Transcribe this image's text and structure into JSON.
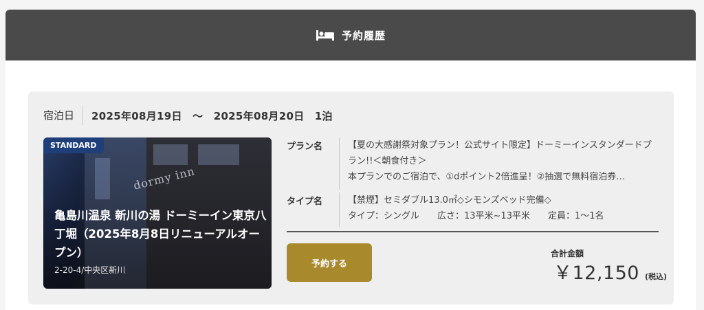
{
  "header": {
    "icon": "bed-icon",
    "title": "予約履歴"
  },
  "stay": {
    "label": "宿泊日",
    "dates_text": "2025年08月19日　～　2025年08月20日　1泊"
  },
  "hotel": {
    "badge": "STANDARD",
    "sign_text": "dormy inn",
    "name": "亀島川温泉 新川の湯 ドーミーイン東京八丁堀（2025年8月8日リニューアルオープン）",
    "address": "2-20-4/中央区新川"
  },
  "plan": {
    "label": "プラン名",
    "value_line1": "【夏の大感謝祭対象プラン！公式サイト限定】ドーミーインスタンダードプラン!!＜朝食付き＞",
    "value_line2": "本プランでのご宿泊で、①dポイント2倍進呈！②抽選で無料宿泊券…"
  },
  "room_type": {
    "label": "タイプ名",
    "value_line1": "【禁煙】セミダブル13.0㎡◇シモンズベッド完備◇",
    "value_line2": "タイプ：シングル　　広さ：13平米~13平米　　定員：1～1名"
  },
  "actions": {
    "reserve_label": "予約する"
  },
  "total": {
    "label": "合計金額",
    "amount": "￥12,150",
    "tax_note": "(税込)"
  },
  "colors": {
    "header_bg": "#4a4a4a",
    "button_bg": "#a88a2d",
    "badge_bg": "#1f3f7a"
  }
}
